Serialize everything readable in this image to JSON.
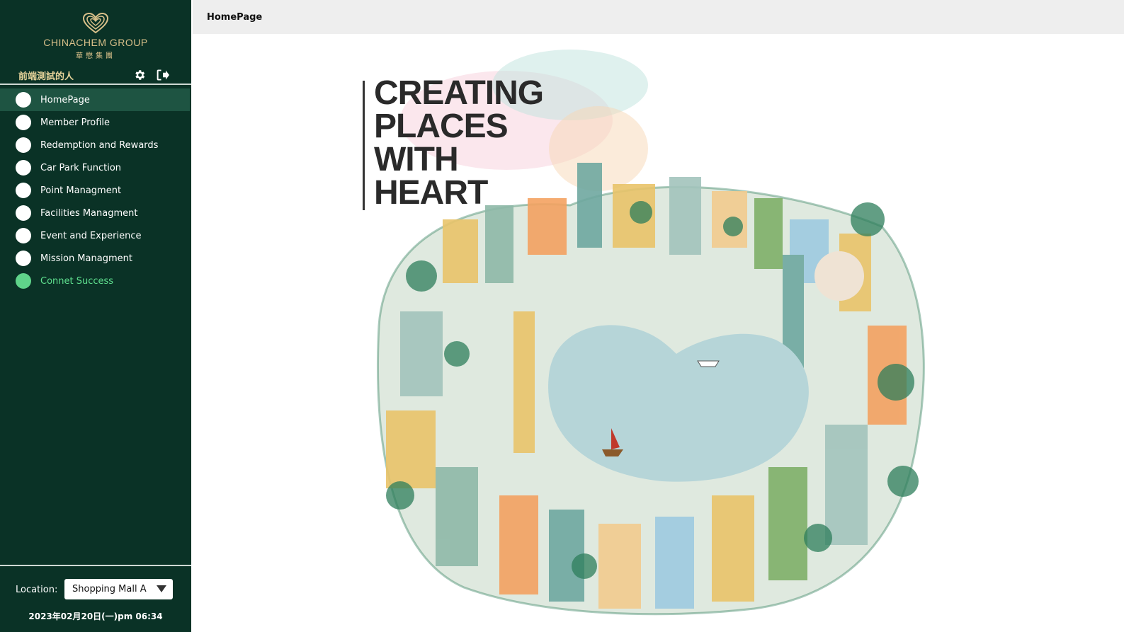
{
  "brand": {
    "name_en": "CHINACHEM GROUP",
    "name_zh": "華懋集團",
    "color": "#d9c08a"
  },
  "user": {
    "name": "前端測試的人"
  },
  "icons": {
    "settings": "gear-icon",
    "logout": "logout-icon",
    "dropdown": "triangle-down-icon"
  },
  "sidebar": {
    "items": [
      {
        "label": "HomePage",
        "active": true
      },
      {
        "label": "Member Profile"
      },
      {
        "label": "Redemption and Rewards"
      },
      {
        "label": "Car Park Function"
      },
      {
        "label": "Point Managment"
      },
      {
        "label": "Facilities Managment"
      },
      {
        "label": "Event and Experience"
      },
      {
        "label": "Mission Managment"
      },
      {
        "label": "Connet Success",
        "status": "connected"
      }
    ]
  },
  "location": {
    "label": "Location:",
    "selected": "Shopping Mall A"
  },
  "datetime": "2023年02月20日(一)pm 06:34",
  "header": {
    "title": "HomePage"
  },
  "poster": {
    "headline": [
      "CREATING",
      "PLACES",
      "WITH",
      "HEART"
    ]
  },
  "colors": {
    "sidebar_bg": "#0a3226",
    "active_item": "#1e5442",
    "status_green": "#5fd48a"
  }
}
